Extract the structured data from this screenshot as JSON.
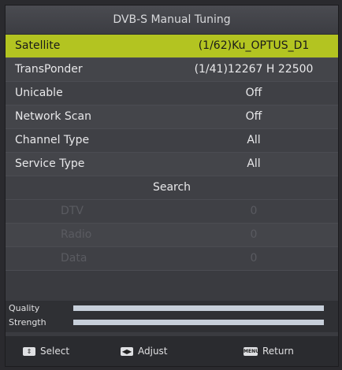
{
  "header": {
    "title": "DVB-S Manual Tuning"
  },
  "rows": [
    {
      "label": "Satellite",
      "value": "(1/62)Ku_OPTUS_D1"
    },
    {
      "label": "TransPonder",
      "value": "(1/41)12267 H 22500"
    },
    {
      "label": "Unicable",
      "value": "Off"
    },
    {
      "label": "Network Scan",
      "value": "Off"
    },
    {
      "label": "Channel Type",
      "value": "All"
    },
    {
      "label": "Service Type",
      "value": "All"
    }
  ],
  "search": {
    "label": "Search"
  },
  "results": [
    {
      "label": "DTV",
      "value": "0"
    },
    {
      "label": "Radio",
      "value": "0"
    },
    {
      "label": "Data",
      "value": "0"
    }
  ],
  "meters": {
    "quality": {
      "label": "Quality",
      "level": 1.0
    },
    "strength": {
      "label": "Strength",
      "level": 1.0
    }
  },
  "footer": {
    "select": "Select",
    "adjust": "Adjust",
    "return": "Return",
    "menu_key": "MENU"
  }
}
